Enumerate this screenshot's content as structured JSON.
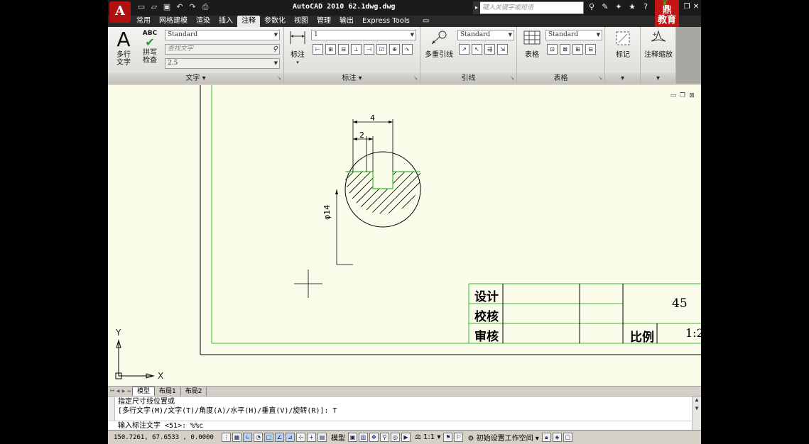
{
  "app": {
    "logo_letter": "A",
    "title": "AutoCAD 2010   62.1dwg.dwg",
    "search_placeholder": "键入关键字或短语",
    "brand_top": "育",
    "brand_mid": "鼎",
    "brand_bottom": "教育"
  },
  "qat_icons": [
    "new-icon",
    "open-icon",
    "save-icon",
    "undo-icon",
    "redo-icon",
    "plot-icon"
  ],
  "tabs": [
    {
      "label": "常用",
      "active": false
    },
    {
      "label": "网格建模",
      "active": false
    },
    {
      "label": "渲染",
      "active": false
    },
    {
      "label": "插入",
      "active": false
    },
    {
      "label": "注释",
      "active": true
    },
    {
      "label": "参数化",
      "active": false
    },
    {
      "label": "视图",
      "active": false
    },
    {
      "label": "管理",
      "active": false
    },
    {
      "label": "输出",
      "active": false
    },
    {
      "label": "Express Tools",
      "active": false
    }
  ],
  "ribbon": {
    "text_panel": {
      "title": "文字",
      "mtext_label_1": "多行",
      "mtext_label_2": "文字",
      "spell_abc": "ABC",
      "spell_label_1": "拼写",
      "spell_label_2": "检查",
      "style_value": "Standard",
      "find_placeholder": "查找文字",
      "height_value": "2.5"
    },
    "dim_panel": {
      "title": "标注",
      "dim_label": "标注",
      "dim_style_value": "1"
    },
    "leader_panel": {
      "title": "引线",
      "mleader_label": "多重引线",
      "leader_style_value": "Standard"
    },
    "table_panel": {
      "title": "表格",
      "table_label": "表格",
      "table_style_value": "Standard"
    },
    "markup_label": "标记",
    "scale_label": "注释缩放"
  },
  "drawing": {
    "dim_top": "4",
    "dim_inner": "2",
    "dim_diameter": "φ14",
    "ucs_x": "X",
    "ucs_y": "Y",
    "title_block": {
      "design": "设计",
      "check": "校核",
      "review": "审核",
      "material": "45",
      "scale_label": "比例",
      "scale_value": "1:2"
    }
  },
  "layout_tabs": [
    "模型",
    "布局1",
    "布局2"
  ],
  "command": {
    "line1": "指定尺寸线位置或",
    "line2": "[多行文字(M)/文字(T)/角度(A)/水平(H)/垂直(V)/旋转(R)]: T",
    "line3": "输入标注文字 <51>: %%c"
  },
  "status": {
    "coords": "150.7261, 67.6533 , 0.0000",
    "model_label": "模型",
    "anno_scale": "1:1",
    "workspace": "初始设置工作空间"
  }
}
